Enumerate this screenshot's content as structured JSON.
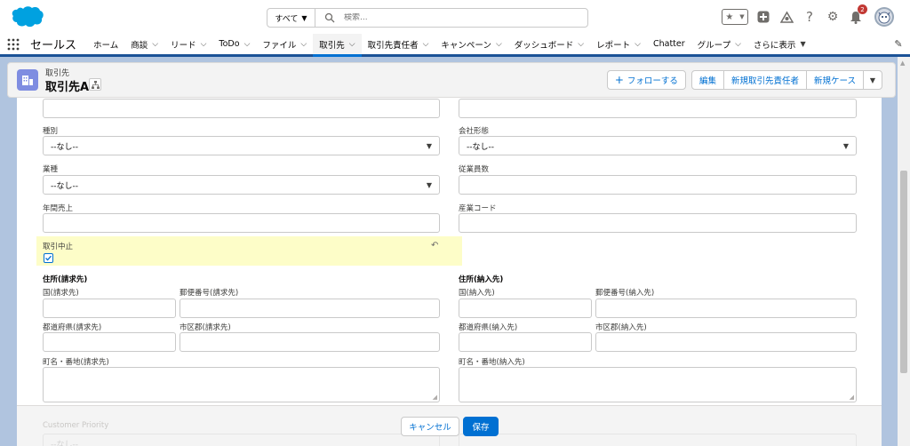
{
  "search": {
    "scope": "すべて",
    "placeholder": "検索..."
  },
  "header": {
    "notification_count": "2"
  },
  "nav": {
    "app_name": "セールス",
    "items": [
      {
        "label": "ホーム",
        "chevron": false
      },
      {
        "label": "商談",
        "chevron": true
      },
      {
        "label": "リード",
        "chevron": true
      },
      {
        "label": "ToDo",
        "chevron": true
      },
      {
        "label": "ファイル",
        "chevron": true
      },
      {
        "label": "取引先",
        "chevron": true,
        "active": true
      },
      {
        "label": "取引先責任者",
        "chevron": true
      },
      {
        "label": "キャンペーン",
        "chevron": true
      },
      {
        "label": "ダッシュボード",
        "chevron": true
      },
      {
        "label": "レポート",
        "chevron": true
      },
      {
        "label": "Chatter",
        "chevron": false
      },
      {
        "label": "グループ",
        "chevron": true
      },
      {
        "label": "さらに表示",
        "chevron": true
      }
    ]
  },
  "record": {
    "object_type": "取引先",
    "title": "取引先A",
    "actions": {
      "follow": "フォローする",
      "edit": "編集",
      "new_contact": "新規取引先責任者",
      "new_case": "新規ケース"
    }
  },
  "form": {
    "type_label": "種別",
    "type_value": "--なし--",
    "ownership_label": "会社形態",
    "ownership_value": "--なし--",
    "industry_label": "業種",
    "industry_value": "--なし--",
    "employees_label": "従業員数",
    "revenue_label": "年間売上",
    "sic_label": "産業コード",
    "suspended_label": "取引中止",
    "suspended_checked": true,
    "billing": {
      "section": "住所(請求先)",
      "country": "国(請求先)",
      "postal": "郵便番号(請求先)",
      "state": "都道府県(請求先)",
      "city": "市区郡(請求先)",
      "street": "町名・番地(請求先)"
    },
    "shipping": {
      "section": "住所(納入先)",
      "country": "国(納入先)",
      "postal": "郵便番号(納入先)",
      "state": "都道府県(納入先)",
      "city": "市区郡(納入先)",
      "street": "町名・番地(納入先)"
    }
  },
  "footer": {
    "cancel": "キャンセル",
    "save": "保存",
    "behind_label": "Customer Priority",
    "behind_value": "--なし--"
  },
  "colors": {
    "brand": "#0070d2",
    "nav_accent": "#1b5297",
    "highlight": "#fdfdc8",
    "backdrop": "#b0c4df"
  }
}
